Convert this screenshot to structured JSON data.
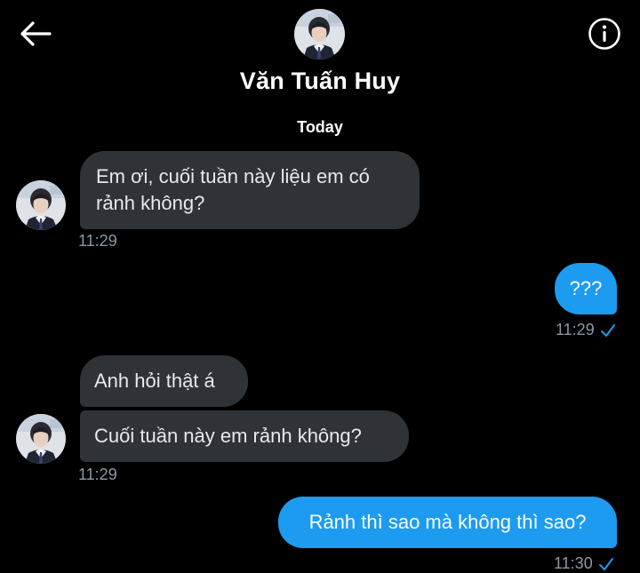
{
  "header": {
    "contact_name": "Văn Tuấn Huy",
    "back_icon": "back-arrow-icon",
    "info_icon": "info-icon"
  },
  "date_separator": "Today",
  "messages": [
    {
      "direction": "incoming",
      "text": "Em ơi, cuối tuần này liệu em có rảnh không?",
      "time": "11:29"
    },
    {
      "direction": "outgoing",
      "text": "???",
      "time": "11:29",
      "status": "sent-check-icon"
    },
    {
      "direction": "incoming",
      "text": "Anh hỏi thật á"
    },
    {
      "direction": "incoming",
      "text": "Cuối tuần này em rảnh không?",
      "time": "11:29"
    },
    {
      "direction": "outgoing",
      "text": "Rảnh thì sao mà không thì sao?",
      "time": "11:30",
      "status": "sent-check-icon"
    }
  ],
  "colors": {
    "background": "#000000",
    "incoming_bubble": "#2f3336",
    "outgoing_bubble": "#1d9bf0",
    "timestamp": "#8b98a5",
    "check": "#1d9bf0"
  }
}
